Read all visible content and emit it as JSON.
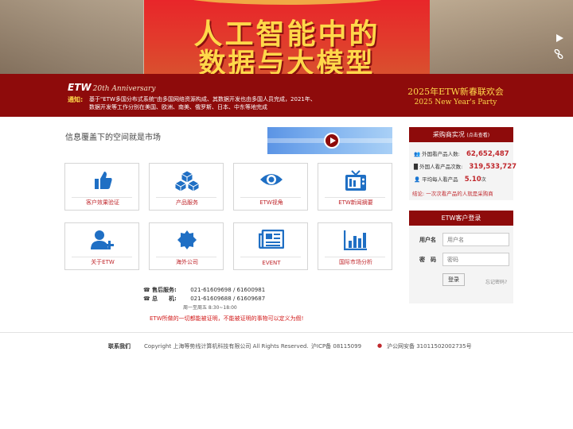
{
  "hero": {
    "poster_line1": "人工智能中的",
    "poster_line2": "数据与大模型",
    "controls": {
      "play_icon": "play-icon",
      "link_icon": "link-icon"
    }
  },
  "banner": {
    "logo_text": "ETW",
    "anniversary": "20th Anniversary",
    "notice_label": "通知:",
    "notice_text": "基于\"ETW多国分布式系统\"由多国网络资源构成、其数据开发也由多国人员完成，2021年、数据开发等工作分别在美国、欧洲、南美、俄罗斯、日本、中东等地完成",
    "party_cn": "2025年ETW新春联欢会",
    "party_en": "2025 New Year's Party"
  },
  "main": {
    "slogan": "信息覆盖下的空间就是市场",
    "tiles": [
      {
        "label": "客户效果验证",
        "icon": "thumbs-up-icon"
      },
      {
        "label": "产品服务",
        "icon": "cubes-icon"
      },
      {
        "label": "ETW视角",
        "icon": "eye-icon"
      },
      {
        "label": "ETW新闻摘要",
        "icon": "tv-icon"
      },
      {
        "label": "关于ETW",
        "icon": "user-plus-icon"
      },
      {
        "label": "海外公司",
        "icon": "badge-icon"
      },
      {
        "label": "EVENT",
        "icon": "newspaper-icon"
      },
      {
        "label": "国际市场分析",
        "icon": "bar-chart-icon"
      }
    ]
  },
  "contact": {
    "service_label": "售后服务:",
    "service_phones": "021-61609698  /  61600981",
    "main_label": "总　　机:",
    "main_phones": "021-61609688  /  61609687",
    "hours": "周一至周五 8:30~18:00",
    "motto": "ETW所做的一切都能被证明，不能被证明的事物可以定义为假!"
  },
  "stats": {
    "title": "采购商实况",
    "title_small": "(点击查看)",
    "rows": [
      {
        "label": "外国看产品人数:",
        "value": "62,652,487",
        "unit": ""
      },
      {
        "label": "外国人看产品次数:",
        "value": "319,533,727",
        "unit": ""
      },
      {
        "label": "平均每人看产品",
        "value": "5.10",
        "unit": "次"
      }
    ],
    "conclusion": "结论: 一次次看产品的人就是采购商"
  },
  "login": {
    "title": "ETW客户登录",
    "username_label": "用户名",
    "username_placeholder": "用户名",
    "password_label": "密　码",
    "password_placeholder": "密码",
    "login_button": "登录",
    "forgot": "忘记密码?"
  },
  "footer": {
    "contact_us": "联系我们",
    "copyright": "Copyright 上海等势线计算机科技有限公司 All Rights Reserved.",
    "icp": "沪ICP备 08115099",
    "police": "沪公网安备 31011502002735号"
  }
}
